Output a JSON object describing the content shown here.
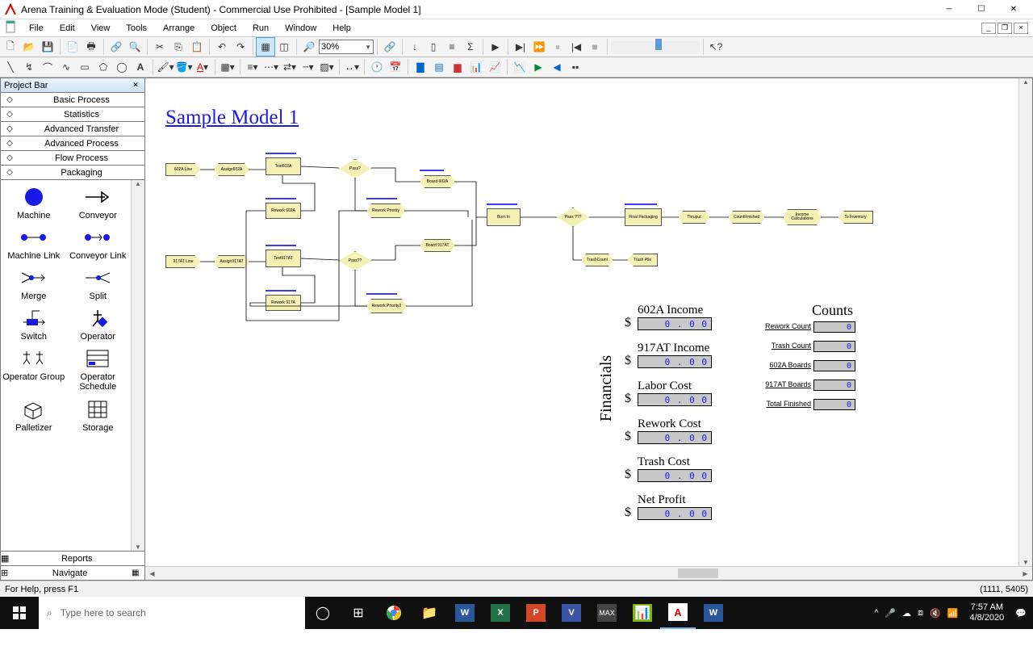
{
  "title": "Arena Training & Evaluation Mode (Student) - Commercial Use Prohibited - [Sample Model 1]",
  "menus": [
    "File",
    "Edit",
    "View",
    "Tools",
    "Arrange",
    "Object",
    "Run",
    "Window",
    "Help"
  ],
  "zoom": "30%",
  "projectbar": {
    "title": "Project Bar",
    "panels": [
      "Basic Process",
      "Statistics",
      "Advanced Transfer",
      "Advanced Process",
      "Flow Process",
      "Packaging"
    ],
    "items": [
      "Machine",
      "Conveyor",
      "Machine Link",
      "Conveyor Link",
      "Merge",
      "Split",
      "Switch",
      "Operator",
      "Operator Group",
      "Operator Schedule",
      "Palletizer",
      "Storage"
    ],
    "footers": [
      "Reports",
      "Navigate"
    ]
  },
  "model": {
    "title": "Sample Model 1",
    "shapes": {
      "602a_line": "602A Line",
      "assign602a": "Assign602A",
      "test602a": "Test602A",
      "pass1": "Pass?",
      "board602a": "Board 602A",
      "rework602a": "Rework 602A",
      "reworkPriority": "Rework Priority",
      "917at_line": "917AT Line",
      "assign917at": "Assign917AT",
      "test917at": "Test917AT",
      "pass2": "Pass??",
      "board917at": "Board 917AT",
      "rework917a": "Rework 917A",
      "reworkPriority2": "Rework Priority2",
      "burnin": "Burn In",
      "pass3": "Pass ???",
      "trashcount": "TrashCount",
      "trashpile": "Trash Pile",
      "finalpack": "Final Packaging",
      "thruput": "Thruput",
      "countfinished": "CountFinished",
      "incomecalc": "Income Calculations",
      "toinventory": "To Inventory"
    }
  },
  "financials": {
    "section": "Financials",
    "rows": [
      {
        "label": "602A Income",
        "val": "0 . 0 0"
      },
      {
        "label": "917AT Income",
        "val": "0 . 0 0"
      },
      {
        "label": "Labor Cost",
        "val": "0 . 0 0"
      },
      {
        "label": "Rework Cost",
        "val": "0 . 0 0"
      },
      {
        "label": "Trash Cost",
        "val": "0 . 0 0"
      },
      {
        "label": "Net Profit",
        "val": "0 . 0 0"
      }
    ]
  },
  "counts": {
    "section": "Counts",
    "rows": [
      {
        "label": "Rework Count",
        "val": "0"
      },
      {
        "label": "Trash Count",
        "val": "0"
      },
      {
        "label": "602A Boards",
        "val": "0"
      },
      {
        "label": "917AT Boards",
        "val": "0"
      },
      {
        "label": "Total Finished",
        "val": "0"
      }
    ]
  },
  "status": {
    "left": "For Help, press F1",
    "right": "(1111, 5405)"
  },
  "taskbar": {
    "search": "Type here to search",
    "time": "7:57 AM",
    "date": "4/8/2020"
  }
}
